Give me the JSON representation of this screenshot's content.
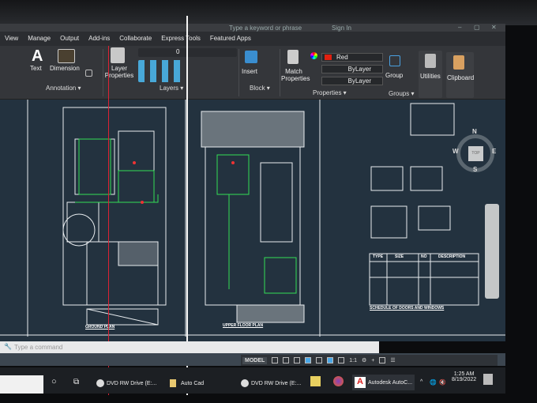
{
  "titlebar": {
    "search_placeholder": "Type a keyword or phrase",
    "sign_in": "Sign In"
  },
  "tabs": [
    "View",
    "Manage",
    "Output",
    "Add-ins",
    "Collaborate",
    "Express Tools",
    "Featured Apps"
  ],
  "ribbon": {
    "annotation": {
      "text": "Text",
      "dimension": "Dimension",
      "panel": "Annotation ▾"
    },
    "layers": {
      "layer_properties": "Layer Properties",
      "current_layer": "0",
      "panel": "Layers ▾"
    },
    "block": {
      "insert": "Insert",
      "panel": "Block ▾"
    },
    "properties": {
      "match": "Match Properties",
      "color": "Red",
      "linetype": "ByLayer",
      "lineweight": "ByLayer",
      "panel": "Properties ▾"
    },
    "groups": {
      "group": "Group",
      "panel": "Groups ▾"
    },
    "utilities": "Utilities",
    "clipboard": "Clipboard"
  },
  "drawing": {
    "ground_plan": "GROUND PLAN",
    "upper_plan": "UPPER FLOOR PLAN",
    "schedule": "SCHEDULE OF DOORS AND WINDOWS",
    "schedule_headers": [
      "TYPE",
      "SIZE",
      "NO",
      "DESCRIPTION"
    ]
  },
  "viewcube": {
    "n": "N",
    "s": "S",
    "e": "E",
    "w": "W",
    "top": "TOP"
  },
  "command": {
    "placeholder": "Type a command"
  },
  "status": {
    "model": "MODEL",
    "scale": "1:1"
  },
  "taskbar": {
    "items": [
      "DVD RW Drive (E:...",
      "Auto Cad",
      "DVD RW Drive (E:...",
      "Autodesk AutoC..."
    ],
    "time": "1:25 AM",
    "date": "8/19/2022"
  },
  "colors": {
    "red_swatch": "#e02010",
    "canvas": "#23323f",
    "ribbon": "#34363a"
  }
}
